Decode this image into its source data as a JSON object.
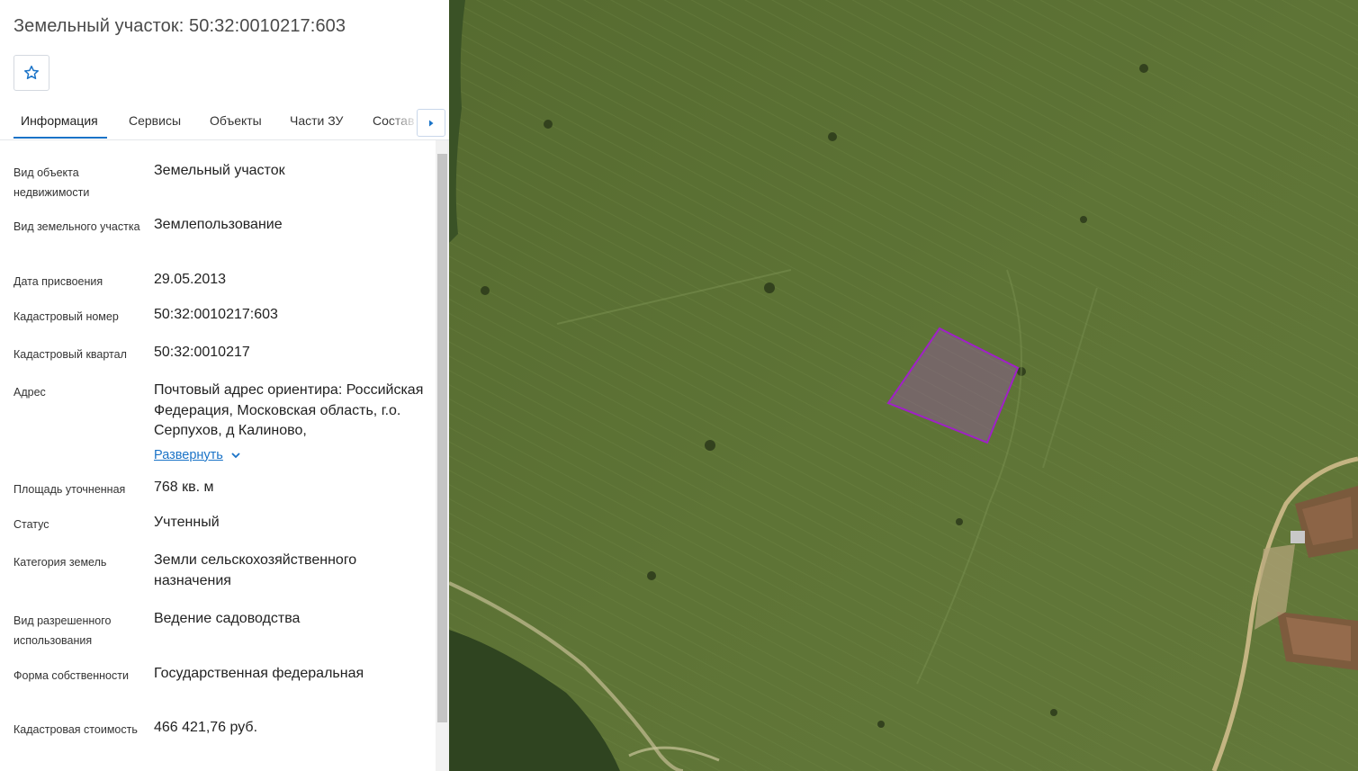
{
  "panel": {
    "title": "Земельный участок: 50:32:0010217:603",
    "favorite_icon": "star-outline-icon",
    "tabs": [
      {
        "label": "Информация",
        "active": true
      },
      {
        "label": "Сервисы",
        "active": false
      },
      {
        "label": "Объекты",
        "active": false
      },
      {
        "label": "Части ЗУ",
        "active": false
      },
      {
        "label": "Состав",
        "active": false
      }
    ],
    "tab_scroll_icon": "caret-right-icon",
    "properties": [
      {
        "label": "Вид объекта недвижимости",
        "value": "Земельный участок"
      },
      {
        "label": "Вид земельного участка",
        "value": "Землепользование"
      },
      {
        "label": "Дата присвоения",
        "value": "29.05.2013"
      },
      {
        "label": "Кадастровый номер",
        "value": "50:32:0010217:603"
      },
      {
        "label": "Кадастровый квартал",
        "value": "50:32:0010217"
      },
      {
        "label": "Адрес",
        "value": "Почтовый адрес ориентира: Российская Федерация, Московская область, г.о. Серпухов, д Калиново,",
        "expand_label": "Развернуть"
      },
      {
        "label": "Площадь уточненная",
        "value": "768 кв. м"
      },
      {
        "label": "Статус",
        "value": "Учтенный"
      },
      {
        "label": "Категория земель",
        "value": "Земли сельскохозяйственного назначения"
      },
      {
        "label": "Вид разрешенного использования",
        "value": "Ведение садоводства"
      },
      {
        "label": "Форма собственности",
        "value": "Государственная федеральная"
      },
      {
        "label": "Кадастровая стоимость",
        "value": "466 421,76 руб."
      }
    ]
  },
  "colors": {
    "accent": "#1a73c7",
    "parcel_stroke": "#a020c8",
    "parcel_fill": "#a050c0"
  }
}
